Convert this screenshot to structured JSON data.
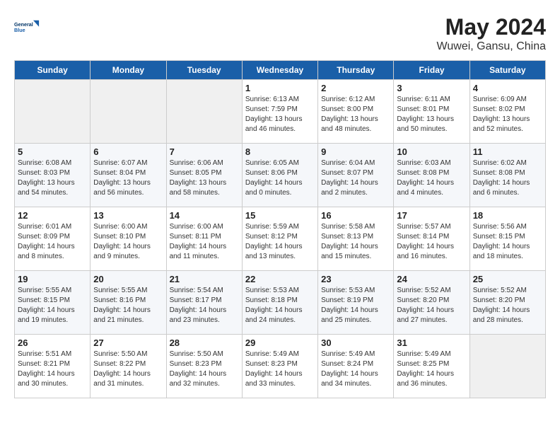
{
  "header": {
    "logo_line1": "General",
    "logo_line2": "Blue",
    "title": "May 2024",
    "subtitle": "Wuwei, Gansu, China"
  },
  "days_of_week": [
    "Sunday",
    "Monday",
    "Tuesday",
    "Wednesday",
    "Thursday",
    "Friday",
    "Saturday"
  ],
  "weeks": [
    [
      {
        "day": "",
        "info": ""
      },
      {
        "day": "",
        "info": ""
      },
      {
        "day": "",
        "info": ""
      },
      {
        "day": "1",
        "info": "Sunrise: 6:13 AM\nSunset: 7:59 PM\nDaylight: 13 hours\nand 46 minutes."
      },
      {
        "day": "2",
        "info": "Sunrise: 6:12 AM\nSunset: 8:00 PM\nDaylight: 13 hours\nand 48 minutes."
      },
      {
        "day": "3",
        "info": "Sunrise: 6:11 AM\nSunset: 8:01 PM\nDaylight: 13 hours\nand 50 minutes."
      },
      {
        "day": "4",
        "info": "Sunrise: 6:09 AM\nSunset: 8:02 PM\nDaylight: 13 hours\nand 52 minutes."
      }
    ],
    [
      {
        "day": "5",
        "info": "Sunrise: 6:08 AM\nSunset: 8:03 PM\nDaylight: 13 hours\nand 54 minutes."
      },
      {
        "day": "6",
        "info": "Sunrise: 6:07 AM\nSunset: 8:04 PM\nDaylight: 13 hours\nand 56 minutes."
      },
      {
        "day": "7",
        "info": "Sunrise: 6:06 AM\nSunset: 8:05 PM\nDaylight: 13 hours\nand 58 minutes."
      },
      {
        "day": "8",
        "info": "Sunrise: 6:05 AM\nSunset: 8:06 PM\nDaylight: 14 hours\nand 0 minutes."
      },
      {
        "day": "9",
        "info": "Sunrise: 6:04 AM\nSunset: 8:07 PM\nDaylight: 14 hours\nand 2 minutes."
      },
      {
        "day": "10",
        "info": "Sunrise: 6:03 AM\nSunset: 8:08 PM\nDaylight: 14 hours\nand 4 minutes."
      },
      {
        "day": "11",
        "info": "Sunrise: 6:02 AM\nSunset: 8:08 PM\nDaylight: 14 hours\nand 6 minutes."
      }
    ],
    [
      {
        "day": "12",
        "info": "Sunrise: 6:01 AM\nSunset: 8:09 PM\nDaylight: 14 hours\nand 8 minutes."
      },
      {
        "day": "13",
        "info": "Sunrise: 6:00 AM\nSunset: 8:10 PM\nDaylight: 14 hours\nand 9 minutes."
      },
      {
        "day": "14",
        "info": "Sunrise: 6:00 AM\nSunset: 8:11 PM\nDaylight: 14 hours\nand 11 minutes."
      },
      {
        "day": "15",
        "info": "Sunrise: 5:59 AM\nSunset: 8:12 PM\nDaylight: 14 hours\nand 13 minutes."
      },
      {
        "day": "16",
        "info": "Sunrise: 5:58 AM\nSunset: 8:13 PM\nDaylight: 14 hours\nand 15 minutes."
      },
      {
        "day": "17",
        "info": "Sunrise: 5:57 AM\nSunset: 8:14 PM\nDaylight: 14 hours\nand 16 minutes."
      },
      {
        "day": "18",
        "info": "Sunrise: 5:56 AM\nSunset: 8:15 PM\nDaylight: 14 hours\nand 18 minutes."
      }
    ],
    [
      {
        "day": "19",
        "info": "Sunrise: 5:55 AM\nSunset: 8:15 PM\nDaylight: 14 hours\nand 19 minutes."
      },
      {
        "day": "20",
        "info": "Sunrise: 5:55 AM\nSunset: 8:16 PM\nDaylight: 14 hours\nand 21 minutes."
      },
      {
        "day": "21",
        "info": "Sunrise: 5:54 AM\nSunset: 8:17 PM\nDaylight: 14 hours\nand 23 minutes."
      },
      {
        "day": "22",
        "info": "Sunrise: 5:53 AM\nSunset: 8:18 PM\nDaylight: 14 hours\nand 24 minutes."
      },
      {
        "day": "23",
        "info": "Sunrise: 5:53 AM\nSunset: 8:19 PM\nDaylight: 14 hours\nand 25 minutes."
      },
      {
        "day": "24",
        "info": "Sunrise: 5:52 AM\nSunset: 8:20 PM\nDaylight: 14 hours\nand 27 minutes."
      },
      {
        "day": "25",
        "info": "Sunrise: 5:52 AM\nSunset: 8:20 PM\nDaylight: 14 hours\nand 28 minutes."
      }
    ],
    [
      {
        "day": "26",
        "info": "Sunrise: 5:51 AM\nSunset: 8:21 PM\nDaylight: 14 hours\nand 30 minutes."
      },
      {
        "day": "27",
        "info": "Sunrise: 5:50 AM\nSunset: 8:22 PM\nDaylight: 14 hours\nand 31 minutes."
      },
      {
        "day": "28",
        "info": "Sunrise: 5:50 AM\nSunset: 8:23 PM\nDaylight: 14 hours\nand 32 minutes."
      },
      {
        "day": "29",
        "info": "Sunrise: 5:49 AM\nSunset: 8:23 PM\nDaylight: 14 hours\nand 33 minutes."
      },
      {
        "day": "30",
        "info": "Sunrise: 5:49 AM\nSunset: 8:24 PM\nDaylight: 14 hours\nand 34 minutes."
      },
      {
        "day": "31",
        "info": "Sunrise: 5:49 AM\nSunset: 8:25 PM\nDaylight: 14 hours\nand 36 minutes."
      },
      {
        "day": "",
        "info": ""
      }
    ]
  ]
}
